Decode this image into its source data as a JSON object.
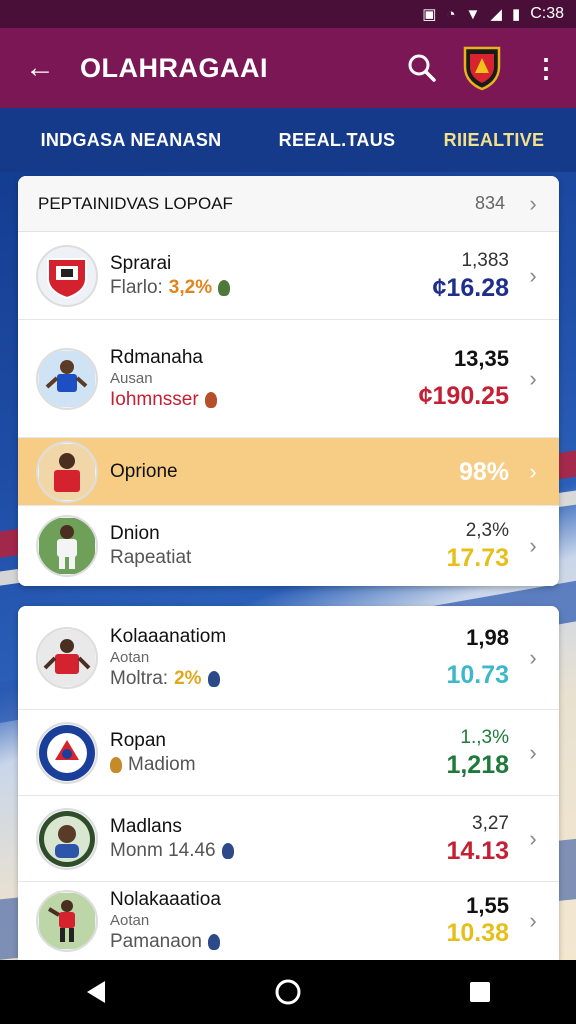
{
  "status": {
    "time": "C:38"
  },
  "appbar": {
    "title": "OLAHRAGAAI"
  },
  "tabs": [
    "INDGASA NEANASN",
    "REEAL.TAUS",
    "RIIEALTIVE"
  ],
  "colors": {
    "appbar": "#7c1756",
    "status": "#4a0f38",
    "highlight": "#f7cd86"
  },
  "card1": {
    "title": "PEPTAINIDVAS LOPOAF",
    "count": "834",
    "rows": [
      {
        "name": "Sprarai",
        "sub": "",
        "sub2": "Flarlo:",
        "pct": "3,2%",
        "pct_color": "#e0841c",
        "v1": "1,383",
        "v2": "¢16.28",
        "v2_color": "#1f2e8a",
        "icon": "club-crest-icon"
      },
      {
        "name": "Rdmanaha",
        "sub": "Ausan",
        "sub2": "Iohmnsser",
        "sub2_color": "#c51f33",
        "pct": "",
        "v1": "13,35",
        "v2": "¢190.25",
        "v2_color": "#c51f33",
        "icon": "player-blue-icon"
      },
      {
        "name": "Oprione",
        "sub": "",
        "sub2": "",
        "pct": "",
        "v1": "",
        "v2": "98%",
        "v2_color": "#ffffff",
        "icon": "player-red-icon"
      },
      {
        "name": "Dnion",
        "sub": "",
        "sub2": "Rapeatiat",
        "pct": "",
        "v1": "2,3%",
        "v2": "17.73",
        "v2_color": "#e6bf1a",
        "icon": "player-white-icon"
      }
    ]
  },
  "card2": {
    "rows": [
      {
        "name": "Kolaaanatiom",
        "sub": "Aotan",
        "sub2": "Moltra:",
        "pct": "2%",
        "pct_color": "#e0a81c",
        "v1": "1,98",
        "v2": "10.73",
        "v2_color": "#3bb8c9",
        "icon": "player-red2-icon"
      },
      {
        "name": "Ropan",
        "sub": "",
        "sub2": "Madiom",
        "pct": "",
        "v1": "1.,3%",
        "v2": "1,218",
        "v2_color": "#1d7a3a",
        "icon": "club-blue-crest-icon"
      },
      {
        "name": "Madlans",
        "sub": "",
        "sub2": "Monm 14.46",
        "pct": "",
        "v1": "3,27",
        "v2": "14.13",
        "v2_color": "#c51f33",
        "icon": "player-portrait-icon"
      },
      {
        "name": "Nolakaaatioa",
        "sub": "Aotan",
        "sub2": "Pamanaon",
        "pct": "",
        "v1": "1,55",
        "v2": "10.38",
        "v2_color": "#e6bf1a",
        "icon": "player-red3-icon"
      }
    ]
  }
}
